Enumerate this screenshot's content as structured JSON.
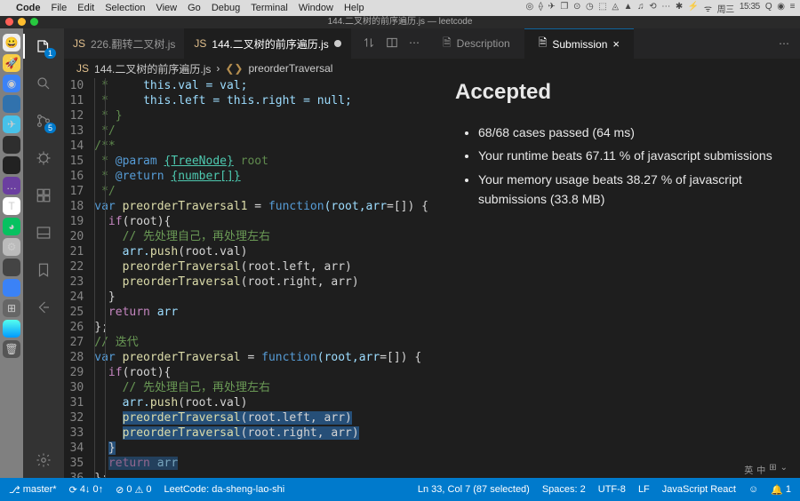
{
  "menubar": {
    "app": "Code",
    "items": [
      "File",
      "Edit",
      "Selection",
      "View",
      "Go",
      "Debug",
      "Terminal",
      "Window",
      "Help"
    ],
    "tray": [
      "◎",
      "⟠",
      "✈",
      "❐",
      "⊙",
      "◷",
      "⬚",
      "◬",
      "▲",
      "♫",
      "⟲",
      "⋯",
      "✱",
      "⚡",
      "ᯤ",
      "周三",
      "15:35",
      "Q",
      "◉",
      "≡"
    ]
  },
  "window": {
    "title": "144.二叉树的前序遍历.js — leetcode"
  },
  "activity": {
    "explorer_badge": "1",
    "scm_badge": "5"
  },
  "tabs": {
    "t0": {
      "label": "226.翻转二叉树.js"
    },
    "t1": {
      "label": "144.二叉树的前序遍历.js"
    }
  },
  "breadcrumb": {
    "file": "144.二叉树的前序遍历.js",
    "symbol": "preorderTraversal"
  },
  "gutter": {
    "start": 10
  },
  "code": {
    "l10": {
      "c": " *     ",
      "t": "this.val = val;"
    },
    "l11": {
      "c": " *     ",
      "t": "this.left = this.right = null;"
    },
    "l12": {
      "c": " * }"
    },
    "l13": {
      "c": " */"
    },
    "l14": {
      "c": "/**"
    },
    "l15": {
      "c": " * ",
      "tag": "@param",
      "type": "{TreeNode}",
      "name": " root"
    },
    "l16": {
      "c": " * ",
      "tag": "@return",
      "type": "{number[]}"
    },
    "l17": {
      "c": " */"
    },
    "l18": {
      "kw": "var",
      "name": " preorderTraversal1 ",
      "eq": "= ",
      "fn": "function",
      "args": "(root,arr",
      "eq2": "=",
      "init": "[]) {"
    },
    "l19": {
      "kw": "if",
      "t": "(root){"
    },
    "l20": {
      "com": "// 先处理自己，再处理左右"
    },
    "l21": {
      "a": "arr.",
      "m": "push",
      "b": "(root.val)"
    },
    "l22": {
      "m": "preorderTraversal",
      "b": "(root.left, arr)"
    },
    "l23": {
      "m": "preorderTraversal",
      "b": "(root.right, arr)"
    },
    "l25": {
      "kw": "return",
      "t": " arr"
    },
    "l27": {
      "com": "// 迭代"
    },
    "l28": {
      "kw": "var",
      "name": " preorderTraversal ",
      "eq": "= ",
      "fn": "function",
      "args": "(root,arr",
      "eq2": "=",
      "init": "[]) {"
    },
    "l29": {
      "kw": "if",
      "t": "(root){"
    },
    "l30": {
      "com": "// 先处理自己，再处理左右"
    },
    "l31": {
      "a": "arr.",
      "m": "push",
      "b": "(root.val)"
    },
    "l32": {
      "m": "preorderTraversal",
      "b": "(root.left, arr)"
    },
    "l33": {
      "m": "preorderTraversal",
      "b": "(root.right, arr)"
    },
    "l35": {
      "kw": "return",
      "t": " arr"
    }
  },
  "result": {
    "tabs": {
      "desc": "Description",
      "sub": "Submission"
    },
    "title": "Accepted",
    "li1": "68/68 cases passed (64 ms)",
    "li2": "Your runtime beats 67.11 % of javascript submissions",
    "li3": "Your memory usage beats 38.27 % of javascript submissions (33.8 MB)"
  },
  "status": {
    "branch": "master*",
    "sync": "4↓ 0↑",
    "problems": "0  0",
    "leetcode": "LeetCode: da-sheng-lao-shi",
    "cursor": "Ln 33, Col 7 (87 selected)",
    "spaces": "Spaces: 2",
    "enc": "UTF-8",
    "eol": "LF",
    "lang": "JavaScript React",
    "bell": "1"
  },
  "mini": {
    "ime": "英",
    "grid": "中"
  }
}
